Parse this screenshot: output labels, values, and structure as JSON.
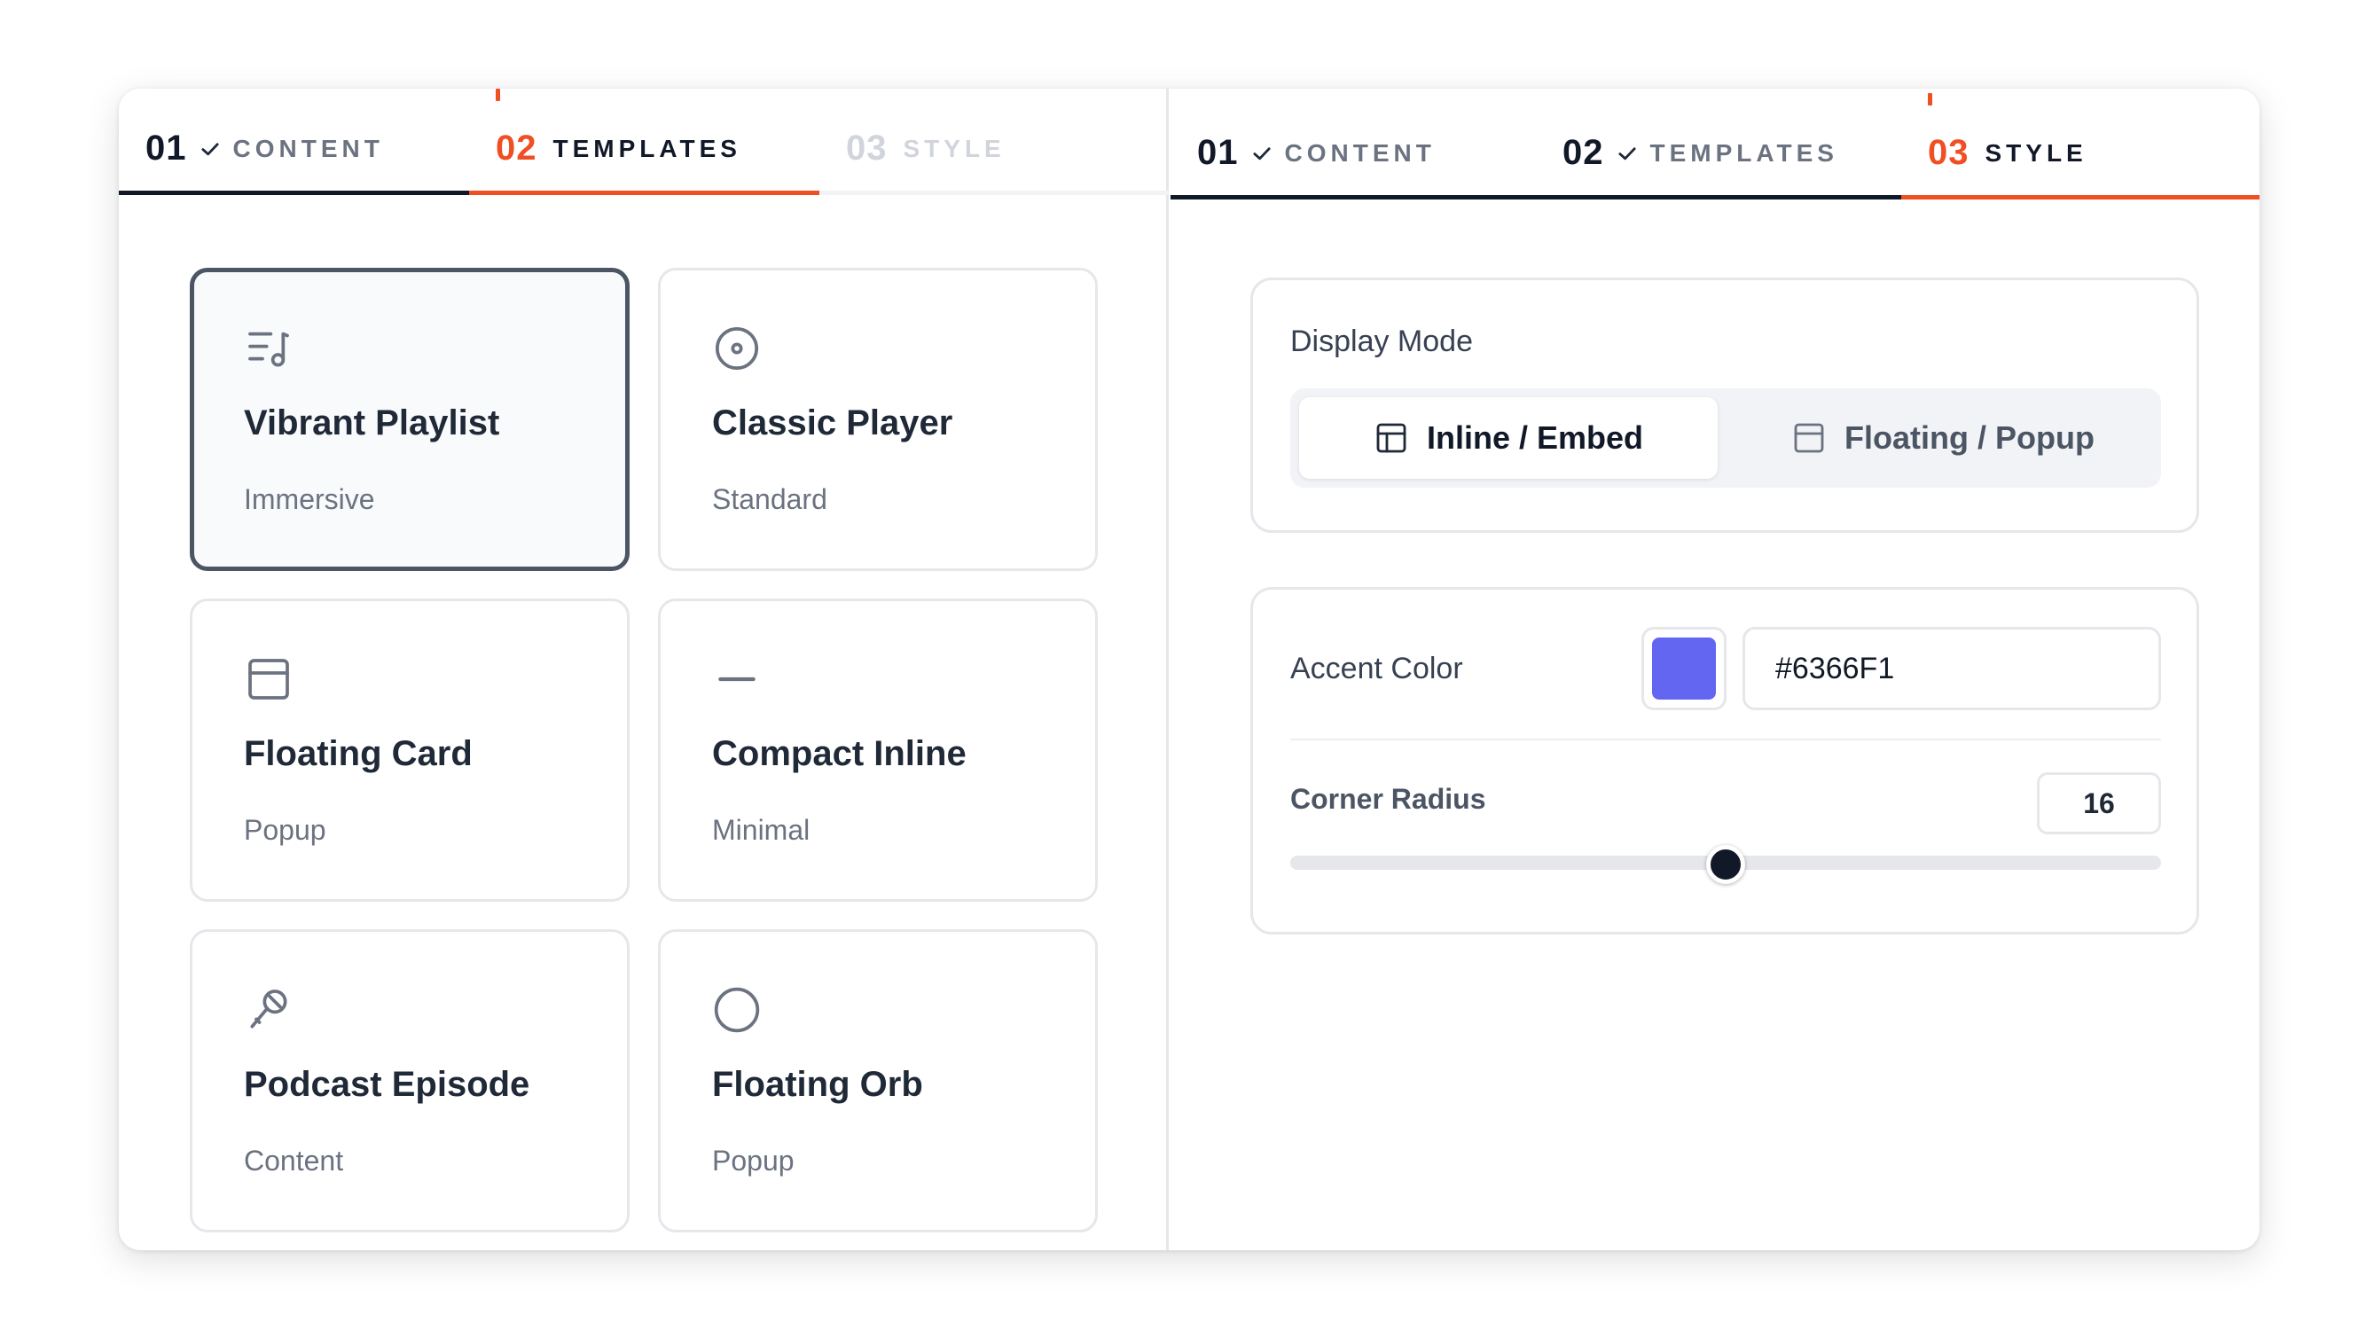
{
  "left_panel": {
    "steps": [
      {
        "num": "01",
        "label": "CONTENT",
        "state": "done"
      },
      {
        "num": "02",
        "label": "TEMPLATES",
        "state": "active"
      },
      {
        "num": "03",
        "label": "STYLE",
        "state": "pending"
      }
    ],
    "templates": [
      {
        "title": "Vibrant Playlist",
        "subtitle": "Immersive",
        "icon": "playlist-music-icon",
        "selected": true
      },
      {
        "title": "Classic Player",
        "subtitle": "Standard",
        "icon": "disc-icon",
        "selected": false
      },
      {
        "title": "Floating Card",
        "subtitle": "Popup",
        "icon": "window-card-icon",
        "selected": false
      },
      {
        "title": "Compact Inline",
        "subtitle": "Minimal",
        "icon": "minus-line-icon",
        "selected": false
      },
      {
        "title": "Podcast Episode",
        "subtitle": "Content",
        "icon": "microphone-icon",
        "selected": false
      },
      {
        "title": "Floating Orb",
        "subtitle": "Popup",
        "icon": "circle-icon",
        "selected": false
      }
    ]
  },
  "right_panel": {
    "steps": [
      {
        "num": "01",
        "label": "CONTENT",
        "state": "done"
      },
      {
        "num": "02",
        "label": "TEMPLATES",
        "state": "done"
      },
      {
        "num": "03",
        "label": "STYLE",
        "state": "active"
      }
    ],
    "display_mode": {
      "label": "Display Mode",
      "options": [
        {
          "label": "Inline / Embed",
          "icon": "layout-panel-icon",
          "selected": true
        },
        {
          "label": "Floating / Popup",
          "icon": "window-icon",
          "selected": false
        }
      ]
    },
    "accent": {
      "label": "Accent Color",
      "value": "#6366F1",
      "swatch_color": "#6366F1"
    },
    "corner_radius": {
      "label": "Corner Radius",
      "value": "16",
      "slider_fraction": 0.5
    }
  },
  "colors": {
    "active_step": "#f04e23",
    "done_step": "#111827",
    "accent": "#6366F1"
  }
}
